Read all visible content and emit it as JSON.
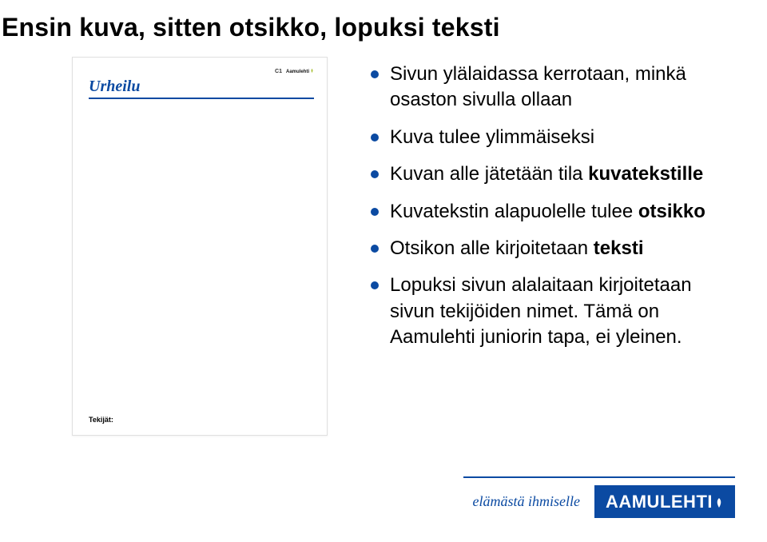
{
  "slide": {
    "title": "Ensin kuva, sitten otsikko, lopuksi teksti"
  },
  "preview": {
    "page_number": "C1",
    "mini_brand": "Aamulehti",
    "section": "Urheilu",
    "tekijat_label": "Tekijät:"
  },
  "bullets": [
    {
      "pre": "Sivun ylälaidassa kerrotaan, minkä osaston sivulla ollaan",
      "bold": "",
      "post": ""
    },
    {
      "pre": "Kuva tulee ylimmäiseksi",
      "bold": "",
      "post": ""
    },
    {
      "pre": "Kuvan alle jätetään tila ",
      "bold": "kuvatekstille",
      "post": ""
    },
    {
      "pre": "Kuvatekstin alapuolelle tulee ",
      "bold": "otsikko",
      "post": ""
    },
    {
      "pre": "Otsikon alle kirjoitetaan ",
      "bold": "teksti",
      "post": ""
    },
    {
      "pre": "Lopuksi sivun alalaitaan kirjoitetaan sivun tekijöiden nimet. Tämä on Aamulehti juniorin tapa, ei yleinen.",
      "bold": "",
      "post": ""
    }
  ],
  "footer": {
    "tagline": "elämästä ihmiselle",
    "brand": "AAMULEHTI"
  }
}
